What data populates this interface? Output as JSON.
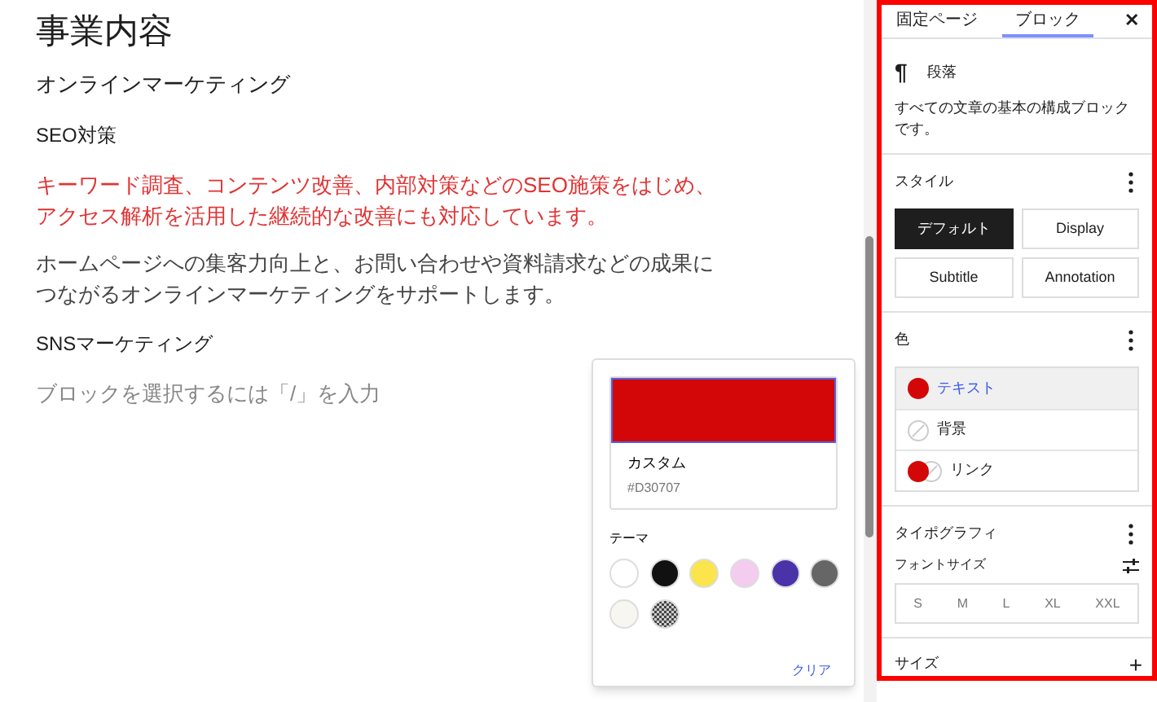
{
  "editor": {
    "blocks": [
      {
        "kind": "title",
        "text": "事業内容"
      },
      {
        "kind": "heading",
        "text": "オンラインマーケティング"
      },
      {
        "kind": "label",
        "text": "SEO対策"
      },
      {
        "kind": "colored",
        "text": "キーワード調査、コンテンツ改善、内部対策などのSEO施策をはじめ、アクセス解析を活用した継続的な改善にも対応しています。"
      },
      {
        "kind": "paragraph",
        "text": "ホームページへの集客力向上と、お問い合わせや資料請求などの成果につながるオンラインマーケティングをサポートします。"
      },
      {
        "kind": "label",
        "text": "SNSマーケティング"
      },
      {
        "kind": "placeholder",
        "text": "ブロックを選択するには「/」を入力"
      }
    ]
  },
  "color_popover": {
    "custom_label": "カスタム",
    "hex": "#D30707",
    "theme_label": "テーマ",
    "swatches": [
      {
        "color": "#ffffff",
        "kind": "solid"
      },
      {
        "color": "#111111",
        "kind": "solid"
      },
      {
        "color": "#fbe44c",
        "kind": "solid"
      },
      {
        "color": "#f3ccef",
        "kind": "solid"
      },
      {
        "color": "#4a32a8",
        "kind": "solid"
      },
      {
        "color": "#666666",
        "kind": "solid"
      },
      {
        "color": "#f8f6f0",
        "kind": "solid"
      },
      {
        "color": "#888888",
        "kind": "pattern"
      }
    ],
    "clear": "クリア"
  },
  "sidebar": {
    "tabs": [
      {
        "label": "固定ページ",
        "selected": false
      },
      {
        "label": "ブロック",
        "selected": true
      }
    ],
    "close": "✕",
    "block": {
      "icon": "¶",
      "name": "段落",
      "description": "すべての文章の基本の構成ブロックです。"
    },
    "style": {
      "title": "スタイル",
      "options": [
        {
          "label": "デフォルト",
          "selected": true
        },
        {
          "label": "Display",
          "selected": false
        },
        {
          "label": "Subtitle",
          "selected": false
        },
        {
          "label": "Annotation",
          "selected": false
        }
      ]
    },
    "color": {
      "title": "色",
      "items": [
        {
          "label": "テキスト",
          "kind": "fill",
          "selected": true
        },
        {
          "label": "背景",
          "kind": "empty",
          "selected": false
        },
        {
          "label": "リンク",
          "kind": "split",
          "selected": false
        }
      ]
    },
    "typography": {
      "title": "タイポグラフィ",
      "font_size_label": "フォントサイズ",
      "sizes": [
        "S",
        "M",
        "L",
        "XL",
        "XXL"
      ]
    },
    "size": {
      "title": "サイズ",
      "add": "+"
    }
  }
}
